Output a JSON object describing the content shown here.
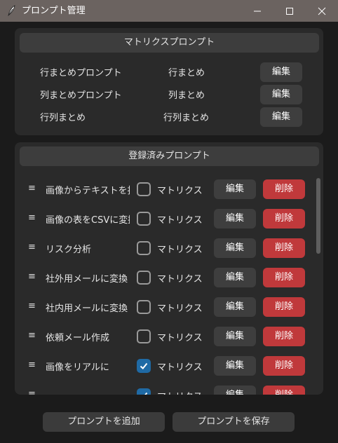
{
  "window": {
    "title": "プロンプト管理"
  },
  "matrix": {
    "header": "マトリクスプロンプト",
    "rows": [
      {
        "name": "行まとめプロンプト",
        "value": "行まとめ",
        "edit_label": "編集"
      },
      {
        "name": "列まとめプロンプト",
        "value": "列まとめ",
        "edit_label": "編集"
      },
      {
        "name": "行列まとめ",
        "value": "行列まとめ",
        "edit_label": "編集"
      }
    ]
  },
  "registered": {
    "header": "登録済みプロンプト",
    "rows": [
      {
        "handle": "≡",
        "name": "画像からテキストを抽出",
        "checkbox_label": "マトリクス",
        "checked": false,
        "edit_label": "編集",
        "delete_label": "削除"
      },
      {
        "handle": "≡",
        "name": "画像の表をCSVに変換",
        "checkbox_label": "マトリクス",
        "checked": false,
        "edit_label": "編集",
        "delete_label": "削除"
      },
      {
        "handle": "≡",
        "name": "リスク分析",
        "checkbox_label": "マトリクス",
        "checked": false,
        "edit_label": "編集",
        "delete_label": "削除"
      },
      {
        "handle": "≡",
        "name": "社外用メールに変換",
        "checkbox_label": "マトリクス",
        "checked": false,
        "edit_label": "編集",
        "delete_label": "削除"
      },
      {
        "handle": "≡",
        "name": "社内用メールに変換",
        "checkbox_label": "マトリクス",
        "checked": false,
        "edit_label": "編集",
        "delete_label": "削除"
      },
      {
        "handle": "≡",
        "name": "依頼メール作成",
        "checkbox_label": "マトリクス",
        "checked": false,
        "edit_label": "編集",
        "delete_label": "削除"
      },
      {
        "handle": "≡",
        "name": "画像をリアルに",
        "checkbox_label": "マトリクス",
        "checked": true,
        "edit_label": "編集",
        "delete_label": "削除"
      },
      {
        "handle": "≡",
        "name": "",
        "checkbox_label": "マトリクス",
        "checked": true,
        "edit_label": "編集",
        "delete_label": "削除"
      }
    ]
  },
  "footer": {
    "add_label": "プロンプトを追加",
    "save_label": "プロンプトを保存"
  },
  "colors": {
    "accent": "#1f6aa5",
    "danger": "#c0393b",
    "titlebar": "#6b6360"
  }
}
